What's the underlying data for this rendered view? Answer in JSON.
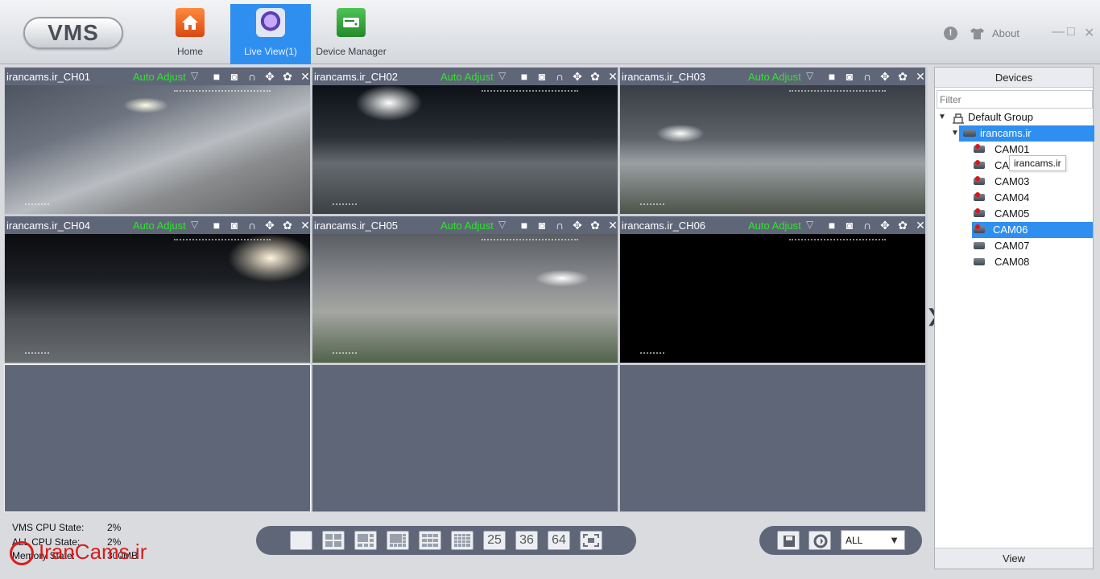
{
  "app": {
    "logo_text": "VMS"
  },
  "nav": {
    "home": "Home",
    "live_view": "Live View(1)",
    "device_manager": "Device Manager",
    "active": "live_view"
  },
  "window": {
    "about": "About",
    "min": "—",
    "max": "□",
    "close": "✕"
  },
  "cells": [
    {
      "name": "irancams.ir_CH01",
      "adjust": "Auto Adjust",
      "has_feed": true
    },
    {
      "name": "irancams.ir_CH02",
      "adjust": "Auto Adjust",
      "has_feed": true
    },
    {
      "name": "irancams.ir_CH03",
      "adjust": "Auto Adjust",
      "has_feed": true
    },
    {
      "name": "irancams.ir_CH04",
      "adjust": "Auto Adjust",
      "has_feed": true
    },
    {
      "name": "irancams.ir_CH05",
      "adjust": "Auto Adjust",
      "has_feed": true
    },
    {
      "name": "irancams.ir_CH06",
      "adjust": "Auto Adjust",
      "has_feed": true
    }
  ],
  "stats": {
    "vms_cpu_label": "VMS CPU State:",
    "vms_cpu_value": "2%",
    "all_cpu_label": "ALL CPU State:",
    "all_cpu_value": "2%",
    "memory_label": "Memory State:",
    "memory_value": "300MB"
  },
  "layout_buttons": [
    "25",
    "36",
    "64"
  ],
  "stream_select": {
    "value": "ALL",
    "options": [
      "ALL"
    ]
  },
  "devices": {
    "header": "Devices",
    "filter_placeholder": "Filter",
    "group": "Default Group",
    "site": "irancams.ir",
    "cameras": [
      {
        "name": "CAM01",
        "online": true
      },
      {
        "name": "CAM02",
        "online": true
      },
      {
        "name": "CAM03",
        "online": true
      },
      {
        "name": "CAM04",
        "online": true
      },
      {
        "name": "CAM05",
        "online": true
      },
      {
        "name": "CAM06",
        "online": true,
        "selected": true
      },
      {
        "name": "CAM07",
        "online": false
      },
      {
        "name": "CAM08",
        "online": false
      }
    ],
    "tooltip": "irancams.ir",
    "footer": "View"
  },
  "watermark": "IranCams.ir",
  "colors": {
    "accent": "#2f8ff0",
    "panel": "#5f6678",
    "adjust": "#2ee52e",
    "alert": "#e01414"
  }
}
